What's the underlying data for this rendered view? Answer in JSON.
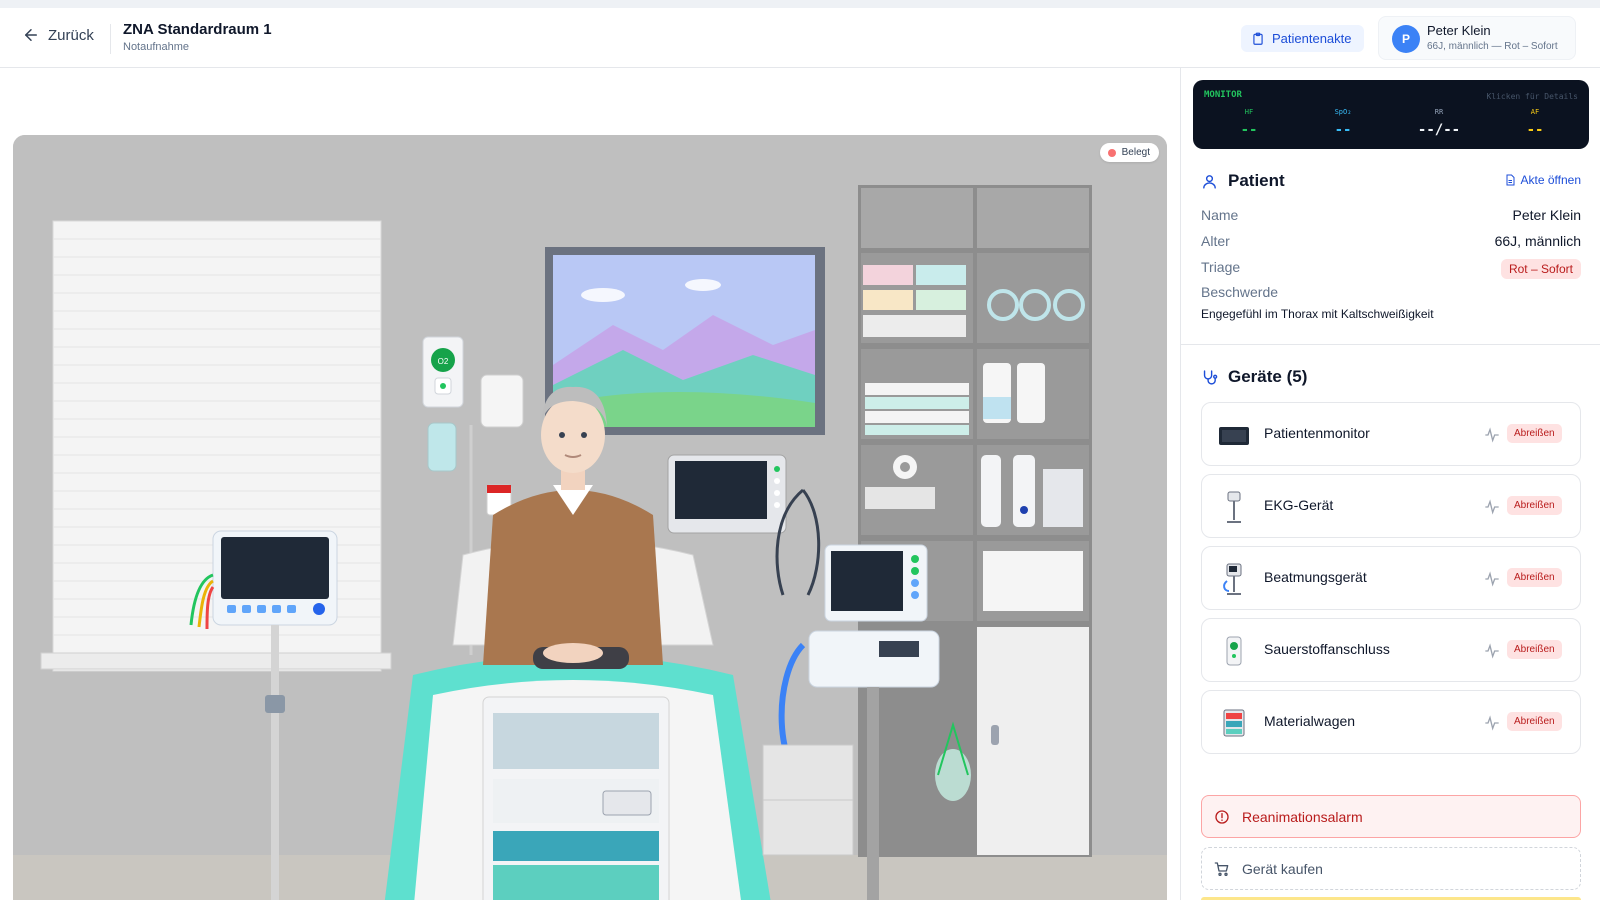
{
  "header": {
    "back_label": "Zurück",
    "room_title": "ZNA Standardraum 1",
    "room_subtitle": "Notaufnahme",
    "record_button": "Patientenakte",
    "user": {
      "initial": "P",
      "name": "Peter Klein",
      "subtitle": "66J, männlich — Rot – Sofort"
    }
  },
  "scene": {
    "status_badge": "Belegt",
    "oxygen_label": "O2"
  },
  "monitor": {
    "title": "MONITOR",
    "hint": "Klicken für Details",
    "vitals": [
      {
        "label": "HF",
        "value": "--",
        "color": "#22c55e"
      },
      {
        "label": "SpO₂",
        "value": "--",
        "color": "#38bdf8"
      },
      {
        "label": "RR",
        "value": "--/--",
        "color": "#f1f5f9"
      },
      {
        "label": "AF",
        "value": "--",
        "color": "#facc15"
      }
    ]
  },
  "patient": {
    "heading": "Patient",
    "open_record": "Akte öffnen",
    "name_label": "Name",
    "name": "Peter Klein",
    "age_label": "Alter",
    "age": "66J, männlich",
    "triage_label": "Triage",
    "triage": "Rot – Sofort",
    "complaint_label": "Beschwerde",
    "complaint": "Engegefühl im Thorax mit Kaltschweißigkeit"
  },
  "devices": {
    "heading": "Geräte (5)",
    "remove_label": "Abreißen",
    "items": [
      {
        "name": "Patientenmonitor",
        "icon": "patient-monitor-icon"
      },
      {
        "name": "EKG-Gerät",
        "icon": "ecg-device-icon"
      },
      {
        "name": "Beatmungsgerät",
        "icon": "ventilator-icon"
      },
      {
        "name": "Sauerstoffanschluss",
        "icon": "oxygen-outlet-icon"
      },
      {
        "name": "Materialwagen",
        "icon": "supply-cart-icon"
      }
    ]
  },
  "actions": {
    "alarm": "Reanimationsalarm",
    "buy": "Gerät kaufen"
  },
  "colors": {
    "accent": "#1d4ed8",
    "danger": "#b91c1c",
    "danger_bg": "#fee2e2",
    "bed_accent": "#5ee0cf"
  }
}
